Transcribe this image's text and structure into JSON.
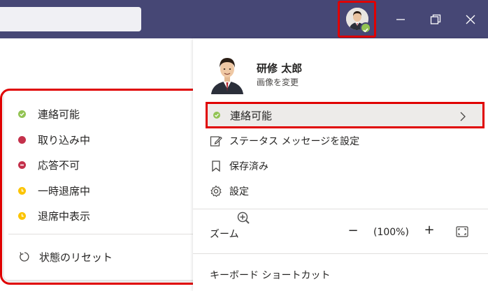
{
  "titlebar": {
    "color": "#464775",
    "minimize_icon": "minimize-icon",
    "restore_icon": "restore-icon",
    "close_icon": "close-icon"
  },
  "status_menu": {
    "items": [
      {
        "label": "連絡可能",
        "color": "#92c353",
        "icon": "available-dot"
      },
      {
        "label": "取り込み中",
        "color": "#c4314b",
        "icon": "busy-dot"
      },
      {
        "label": "応答不可",
        "color": "#c4314b",
        "icon": "do-not-disturb-icon"
      },
      {
        "label": "一時退席中",
        "color": "#fcc400",
        "icon": "away-clock-icon"
      },
      {
        "label": "退席中表示",
        "color": "#fcc400",
        "icon": "away-clock-icon"
      }
    ],
    "reset_label": "状態のリセット"
  },
  "profile": {
    "name": "研修 太郎",
    "change_photo": "画像を変更",
    "status_label": "連絡可能",
    "status_color": "#92c353",
    "status_message_label": "ステータス メッセージを設定",
    "saved_label": "保存済み",
    "settings_label": "設定",
    "zoom_label": "ズーム",
    "zoom_minus": "−",
    "zoom_value": "(100%)",
    "zoom_plus": "+",
    "shortcuts_label": "キーボード ショートカット"
  },
  "highlight_color": "#e00000"
}
